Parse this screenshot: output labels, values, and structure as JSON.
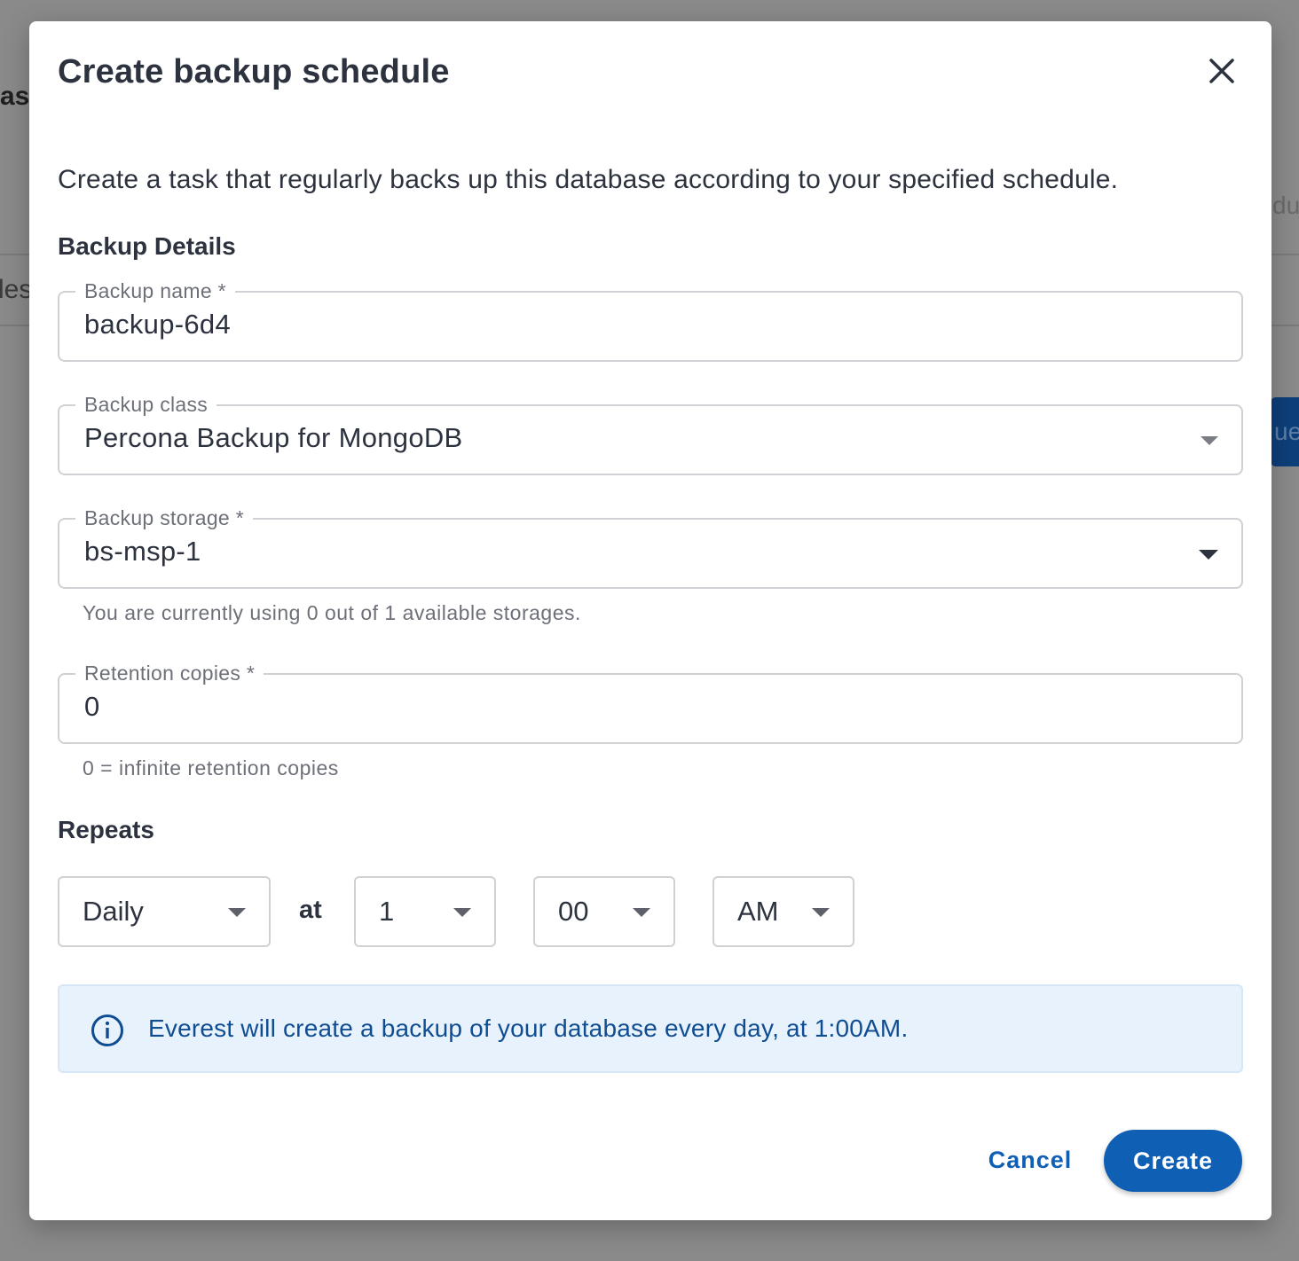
{
  "background": {
    "fragment_1": "as",
    "fragment_2": "les",
    "fragment_3": "dul",
    "fragment_4": "ue"
  },
  "dialog": {
    "title": "Create backup schedule",
    "description": "Create a task that regularly backs up this database according to your specified schedule.",
    "section_details": "Backup Details",
    "backup_name": {
      "label": "Backup name *",
      "value": "backup-6d4"
    },
    "backup_class": {
      "label": "Backup class",
      "value": "Percona Backup for MongoDB"
    },
    "backup_storage": {
      "label": "Backup storage *",
      "value": "bs-msp-1",
      "helper": "You are currently using 0 out of 1 available storages."
    },
    "retention": {
      "label": "Retention copies *",
      "value": "0",
      "helper": "0 = infinite retention copies"
    },
    "section_repeats": "Repeats",
    "schedule": {
      "frequency": "Daily",
      "at_label": "at",
      "hour": "1",
      "minute": "00",
      "ampm": "AM"
    },
    "info_message": "Everest will create a backup of your database every day, at 1:00AM.",
    "cancel_label": "Cancel",
    "create_label": "Create"
  },
  "colors": {
    "primary": "#0f5fb5",
    "info_background": "#e8f2fc",
    "info_text": "#0f4d93",
    "overlay": "#8a8a8a"
  },
  "icons": {
    "close": "close-icon",
    "info": "info-icon",
    "dropdown": "chevron-down-icon"
  }
}
